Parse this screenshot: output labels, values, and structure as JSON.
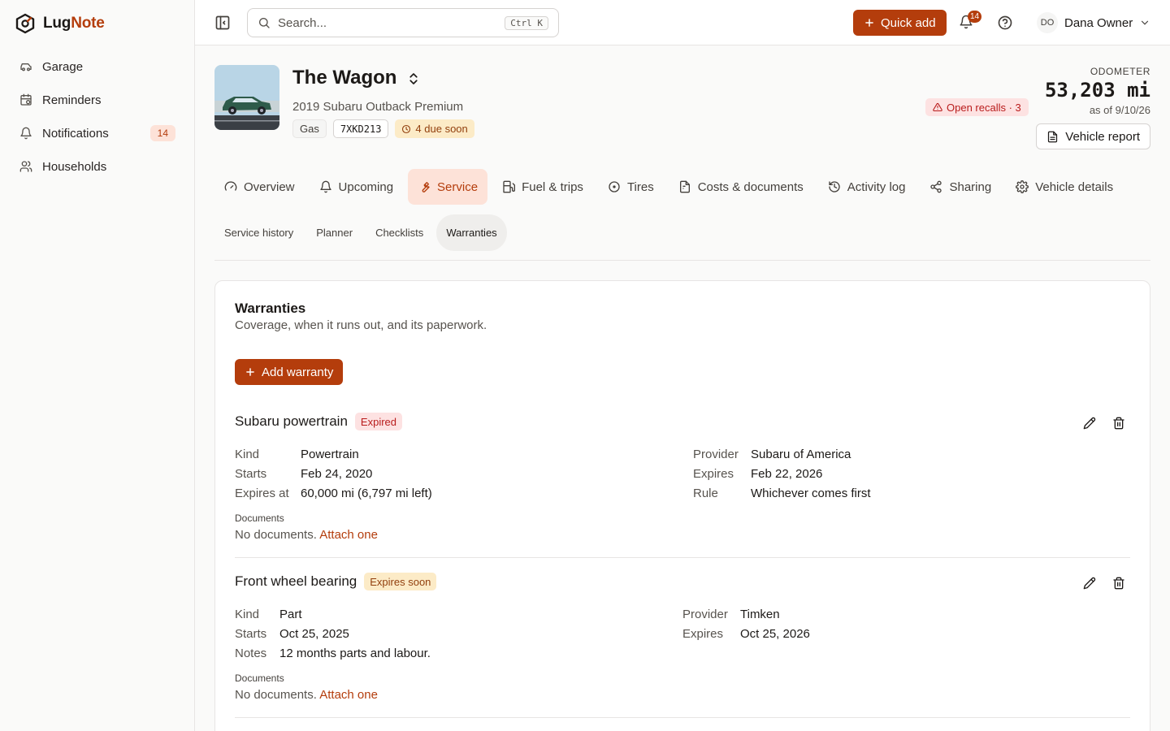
{
  "app": {
    "name_part1": "Lug",
    "name_part2": "Note"
  },
  "sidebar": {
    "items": [
      {
        "label": "Garage",
        "icon": "car-icon"
      },
      {
        "label": "Reminders",
        "icon": "calendar-clock-icon"
      },
      {
        "label": "Notifications",
        "icon": "bell-icon",
        "badge": "14"
      },
      {
        "label": "Households",
        "icon": "users-icon"
      }
    ]
  },
  "header": {
    "search_placeholder": "Search...",
    "search_shortcut": "Ctrl K",
    "quick_add": "Quick add",
    "notification_count": "14",
    "user_initials": "DO",
    "user_name": "Dana Owner"
  },
  "vehicle": {
    "name": "The Wagon",
    "subtitle": "2019 Subaru Outback Premium",
    "fuel": "Gas",
    "plate": "7XKD213",
    "due_soon": "4 due soon",
    "recalls": "Open recalls · 3",
    "odometer_label": "ODOMETER",
    "odometer_value": "53,203 mi",
    "odometer_asof": "as of 9/10/26",
    "report_button": "Vehicle report"
  },
  "tabs": [
    {
      "label": "Overview",
      "icon": "gauge-icon"
    },
    {
      "label": "Upcoming",
      "icon": "bell-icon"
    },
    {
      "label": "Service",
      "icon": "wrench-icon",
      "active": true
    },
    {
      "label": "Fuel & trips",
      "icon": "fuel-icon"
    },
    {
      "label": "Tires",
      "icon": "circle-dot-icon"
    },
    {
      "label": "Costs & documents",
      "icon": "receipt-icon"
    },
    {
      "label": "Activity log",
      "icon": "history-icon"
    },
    {
      "label": "Sharing",
      "icon": "share-icon"
    },
    {
      "label": "Vehicle details",
      "icon": "gear-icon"
    }
  ],
  "subtabs": [
    {
      "label": "Service history"
    },
    {
      "label": "Planner"
    },
    {
      "label": "Checklists"
    },
    {
      "label": "Warranties",
      "active": true
    }
  ],
  "warranties_card": {
    "title": "Warranties",
    "subtitle": "Coverage, when it runs out, and its paperwork.",
    "add_button": "Add warranty",
    "documents_label": "Documents",
    "no_documents": "No documents.",
    "attach_link": "Attach one",
    "items": [
      {
        "name": "Subaru powertrain",
        "status": "Expired",
        "left": [
          {
            "k": "Kind",
            "v": "Powertrain"
          },
          {
            "k": "Starts",
            "v": "Feb 24, 2020"
          },
          {
            "k": "Expires at",
            "v": "60,000 mi (6,797 mi left)"
          }
        ],
        "right": [
          {
            "k": "Provider",
            "v": "Subaru of America"
          },
          {
            "k": "Expires",
            "v": "Feb 22, 2026"
          },
          {
            "k": "Rule",
            "v": "Whichever comes first"
          }
        ]
      },
      {
        "name": "Front wheel bearing",
        "status": "Expires soon",
        "left": [
          {
            "k": "Kind",
            "v": "Part"
          },
          {
            "k": "Starts",
            "v": "Oct 25, 2025"
          },
          {
            "k": "Notes",
            "v": "12 months parts and labour."
          }
        ],
        "right": [
          {
            "k": "Provider",
            "v": "Timken"
          },
          {
            "k": "Expires",
            "v": "Oct 25, 2026"
          }
        ]
      }
    ]
  },
  "colors": {
    "accent": "#b43d0c",
    "danger": "#b91c1c",
    "warning": "#92400e"
  }
}
